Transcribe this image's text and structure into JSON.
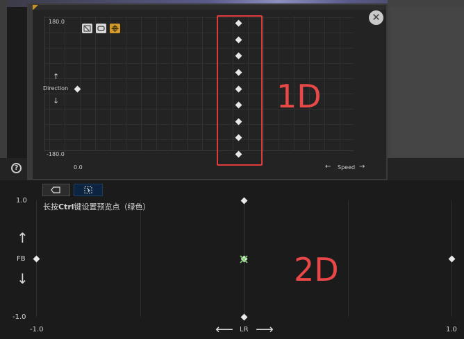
{
  "popup_1d": {
    "y_max": "180.0",
    "y_min": "-180.0",
    "x_min": "0.0",
    "y_axis_label": "Direction",
    "y_axis_up_arrow": "↑",
    "y_axis_down_arrow": "↓",
    "x_axis_label": "Speed",
    "x_axis_left_arrow": "←",
    "x_axis_right_arrow": "→",
    "close_glyph": "✕",
    "annotation": "1D",
    "highlight_color": "#e23b3b",
    "tools": [
      "select-icon",
      "frame-icon",
      "move-icon"
    ],
    "sample_points": 9
  },
  "help": {
    "glyph": "?"
  },
  "toolbar_2d": {
    "frame_glyph": "▭",
    "select_glyph": "⬚"
  },
  "graph_2d": {
    "y_max": "1.0",
    "y_min": "-1.0",
    "x_min": "-1.0",
    "x_max": "1.0",
    "y_axis_label": "FB",
    "x_axis_label": "LR",
    "up_arrow": "↑",
    "down_arrow": "↓",
    "left_arrow": "⟵",
    "right_arrow": "⟶",
    "hint_prefix": "长按",
    "hint_key": "Ctrl",
    "hint_suffix": "键设置预览点（绿色）",
    "annotation": "2D",
    "preview_color": "#7bd36a"
  }
}
